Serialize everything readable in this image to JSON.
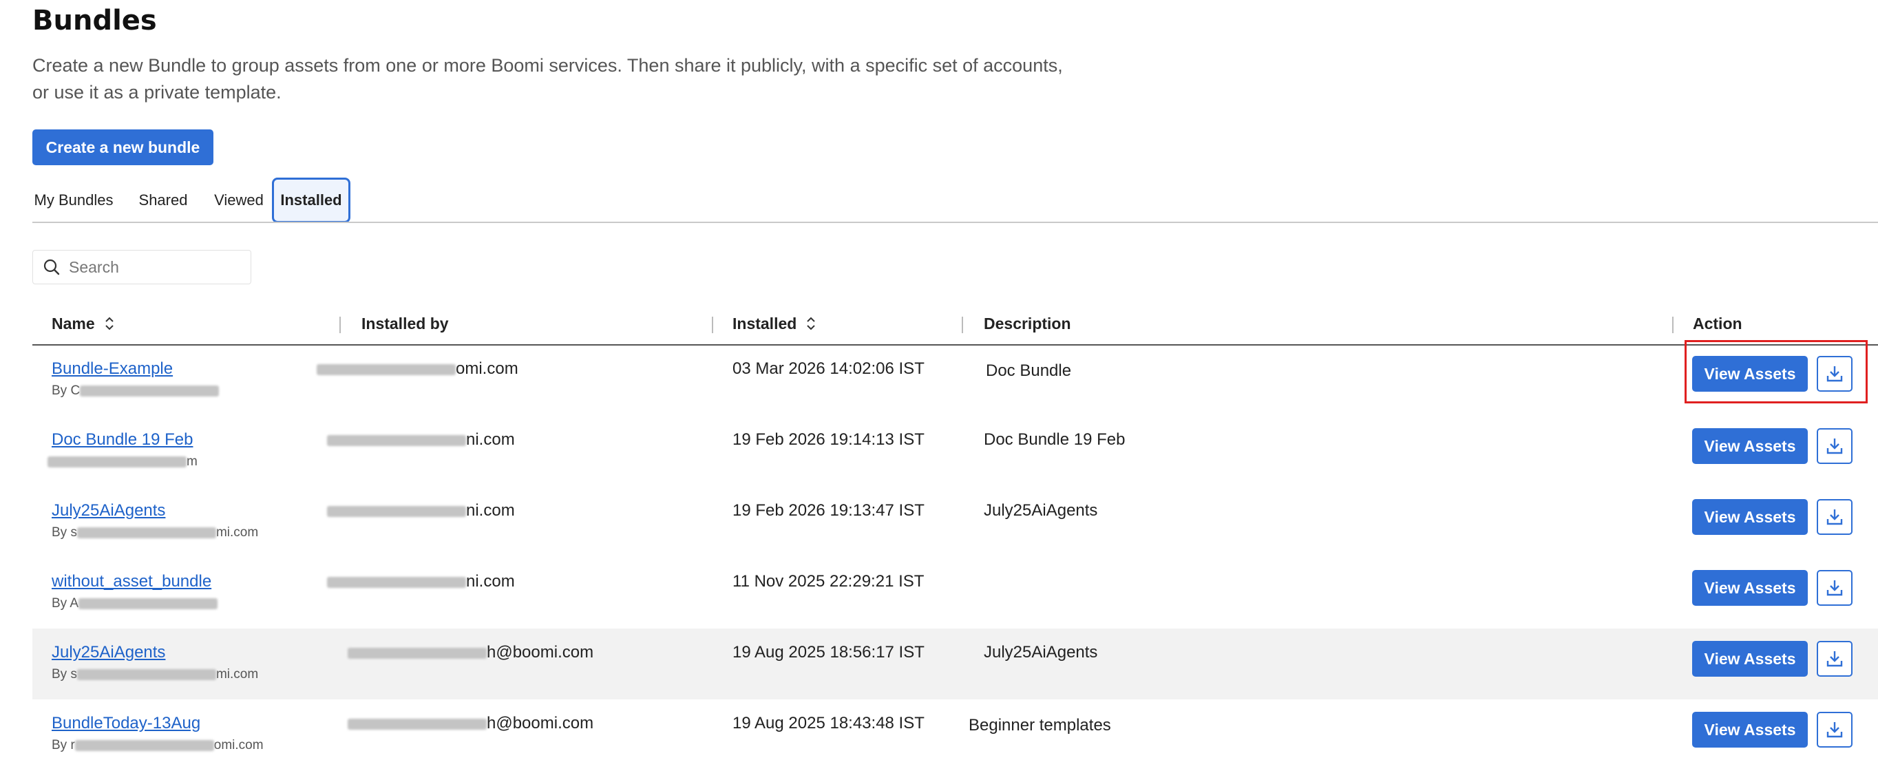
{
  "page": {
    "title": "Bundles",
    "intro_line1": "Create a new Bundle to group assets from one or more Boomi services. Then share it publicly, with a specific set of accounts,",
    "intro_line2": "or use it as a private template.",
    "create_button": "Create a new bundle"
  },
  "tabs": [
    {
      "label": "My Bundles",
      "active": false
    },
    {
      "label": "Shared",
      "active": false
    },
    {
      "label": "Viewed",
      "active": false
    },
    {
      "label": "Installed",
      "active": true
    }
  ],
  "search": {
    "placeholder": "Search",
    "icon": "search-icon"
  },
  "table": {
    "columns": {
      "name": "Name",
      "installed_by": "Installed by",
      "installed": "Installed",
      "description": "Description",
      "action": "Action"
    },
    "action_labels": {
      "view": "View Assets",
      "download_icon": "download-icon"
    },
    "rows": [
      {
        "name": "Bundle-Example",
        "by_prefix": "By C",
        "by_suffix": "",
        "installed_by_suffix": "omi.com",
        "installed": "03 Mar 2026 14:02:06 IST",
        "description": "Doc Bundle",
        "highlighted": true
      },
      {
        "name": "Doc Bundle 19 Feb",
        "by_prefix": "",
        "by_suffix": "m",
        "installed_by_suffix": "ni.com",
        "installed": "19 Feb 2026 19:14:13 IST",
        "description": "Doc Bundle 19 Feb"
      },
      {
        "name": "July25AiAgents",
        "by_prefix": "By s",
        "by_suffix": "mi.com",
        "installed_by_suffix": "ni.com",
        "installed": "19 Feb 2026 19:13:47 IST",
        "description": "July25AiAgents"
      },
      {
        "name": "without_asset_bundle",
        "by_prefix": "By A",
        "by_suffix": "",
        "installed_by_suffix": "ni.com",
        "installed": "11 Nov 2025 22:29:21 IST",
        "description": ""
      },
      {
        "name": "July25AiAgents",
        "by_prefix": "By s",
        "by_suffix": "mi.com",
        "installed_by_suffix": "h@boomi.com",
        "installed": "19 Aug 2025 18:56:17 IST",
        "description": "July25AiAgents",
        "shaded": true
      },
      {
        "name": "BundleToday-13Aug",
        "by_prefix": "By r",
        "by_suffix": "omi.com",
        "installed_by_suffix": "h@boomi.com",
        "installed": "19 Aug 2025 18:43:48 IST",
        "description": "Beginner templates"
      }
    ]
  },
  "colors": {
    "primary": "#2f6fd6",
    "link": "#1e62c9",
    "highlight": "#e02020"
  }
}
